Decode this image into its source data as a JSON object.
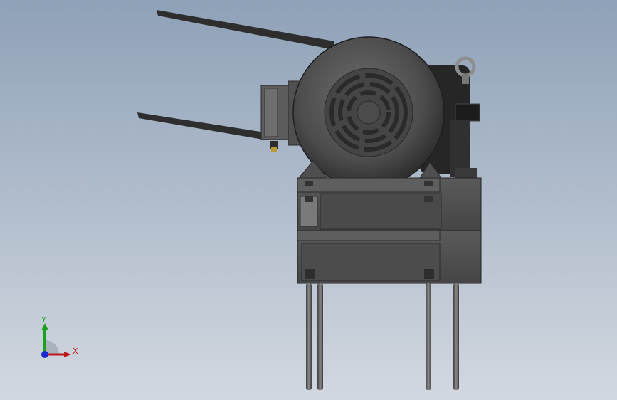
{
  "viewport": {
    "background_top": "#8fa1b8",
    "background_bottom": "#d2d8e0"
  },
  "model": {
    "body_color": "#4a4a4a",
    "shadow_color": "#2b2b2b",
    "highlight_color": "#7a7a7a"
  },
  "triad": {
    "x_label": "X",
    "y_label": "Y",
    "x_color": "#c0141c",
    "y_color": "#1aa01a",
    "z_color": "#1a2ad0"
  }
}
